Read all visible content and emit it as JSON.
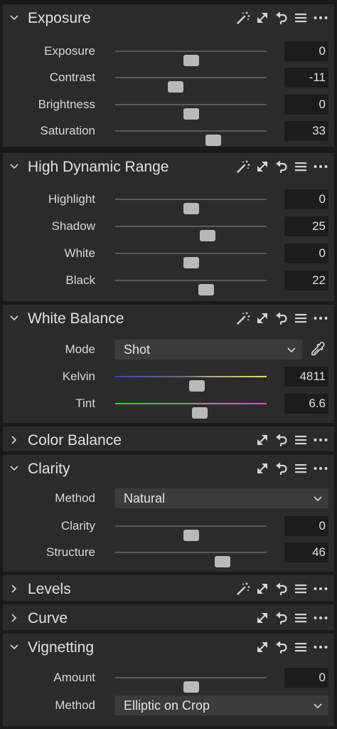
{
  "panels": {
    "exposure": {
      "title": "Exposure",
      "expanded": true,
      "icons": [
        "auto-adjust-icon",
        "copy-apply-icon",
        "reset-icon",
        "menu-icon",
        "more-icon"
      ],
      "rows": [
        {
          "label": "Exposure",
          "value": "0",
          "slider_fraction": 0.5
        },
        {
          "label": "Contrast",
          "value": "-11",
          "slider_fraction": 0.4
        },
        {
          "label": "Brightness",
          "value": "0",
          "slider_fraction": 0.5
        },
        {
          "label": "Saturation",
          "value": "33",
          "slider_fraction": 0.65
        }
      ]
    },
    "hdr": {
      "title": "High Dynamic Range",
      "expanded": true,
      "icons": [
        "auto-adjust-icon",
        "copy-apply-icon",
        "reset-icon",
        "menu-icon",
        "more-icon"
      ],
      "rows": [
        {
          "label": "Highlight",
          "value": "0",
          "slider_fraction": 0.5
        },
        {
          "label": "Shadow",
          "value": "25",
          "slider_fraction": 0.61
        },
        {
          "label": "White",
          "value": "0",
          "slider_fraction": 0.5
        },
        {
          "label": "Black",
          "value": "22",
          "slider_fraction": 0.6
        }
      ]
    },
    "white_balance": {
      "title": "White Balance",
      "expanded": true,
      "icons": [
        "auto-adjust-icon",
        "copy-apply-icon",
        "reset-icon",
        "menu-icon",
        "more-icon"
      ],
      "mode_label": "Mode",
      "mode_value": "Shot",
      "rows": [
        {
          "label": "Kelvin",
          "value": "4811",
          "slider_fraction": 0.54
        },
        {
          "label": "Tint",
          "value": "6.6",
          "slider_fraction": 0.56
        }
      ]
    },
    "color_balance": {
      "title": "Color Balance",
      "expanded": false,
      "icons": [
        "copy-apply-icon",
        "reset-icon",
        "menu-icon",
        "more-icon"
      ]
    },
    "clarity": {
      "title": "Clarity",
      "expanded": true,
      "icons": [
        "copy-apply-icon",
        "reset-icon",
        "menu-icon",
        "more-icon"
      ],
      "method_label": "Method",
      "method_value": "Natural",
      "rows": [
        {
          "label": "Clarity",
          "value": "0",
          "slider_fraction": 0.5
        },
        {
          "label": "Structure",
          "value": "46",
          "slider_fraction": 0.71
        }
      ]
    },
    "levels": {
      "title": "Levels",
      "expanded": false,
      "icons": [
        "auto-adjust-icon",
        "copy-apply-icon",
        "reset-icon",
        "menu-icon",
        "more-icon"
      ]
    },
    "curve": {
      "title": "Curve",
      "expanded": false,
      "icons": [
        "copy-apply-icon",
        "reset-icon",
        "menu-icon",
        "more-icon"
      ]
    },
    "vignetting": {
      "title": "Vignetting",
      "expanded": true,
      "icons": [
        "copy-apply-icon",
        "reset-icon",
        "menu-icon",
        "more-icon"
      ],
      "rows": [
        {
          "label": "Amount",
          "value": "0",
          "slider_fraction": 0.5
        }
      ],
      "method_label": "Method",
      "method_value": "Elliptic on Crop"
    }
  },
  "colors": {
    "panel_bg": "#2b2b2b",
    "app_bg": "#191919",
    "value_box_bg": "#1c1c1c",
    "thumb": "#b9b9b9",
    "text": "#dcdcdc"
  }
}
